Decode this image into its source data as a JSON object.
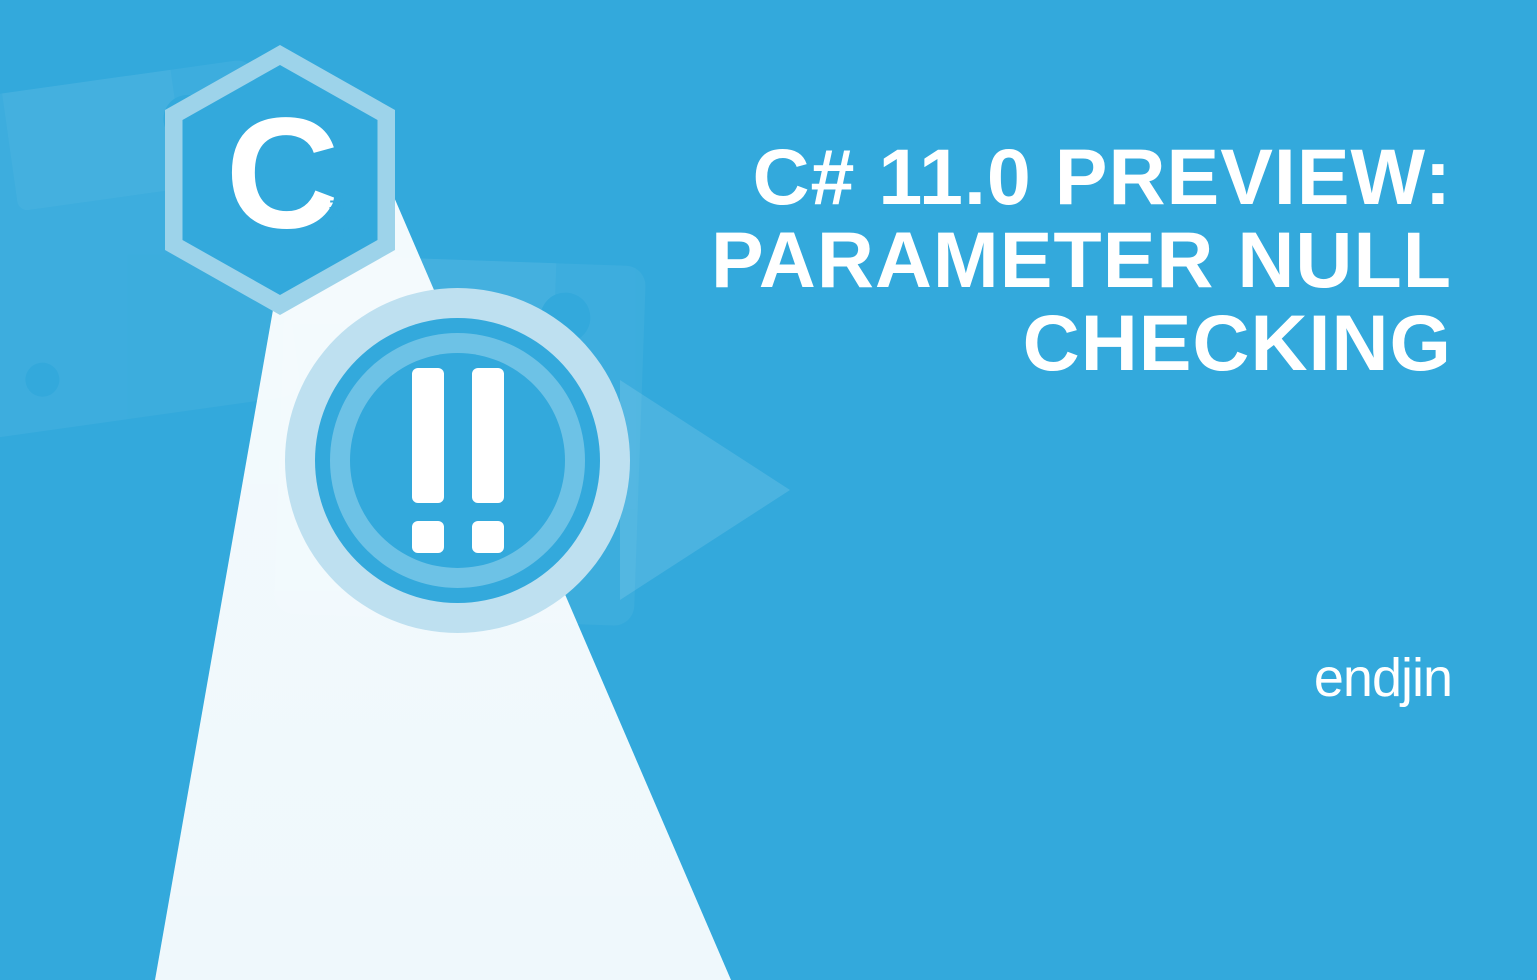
{
  "title": {
    "line1": "C# 11.0 PREVIEW:",
    "line2": "PARAMETER NULL",
    "line3": "CHECKING"
  },
  "badge": {
    "language_letter": "C",
    "language_hash": "#",
    "symbol": "!!"
  },
  "brand": {
    "name": "endjin"
  },
  "colors": {
    "background": "#33a9dc",
    "accent_light": "#bee0f0",
    "accent_mid": "#6dc2e6",
    "white": "#ffffff"
  }
}
